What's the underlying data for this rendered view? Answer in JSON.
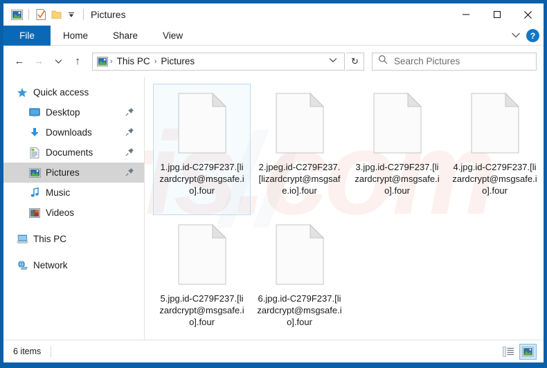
{
  "window": {
    "title": "Pictures",
    "quick_access_icons": [
      "pictures-folder-icon",
      "properties-checkmark-icon",
      "new-folder-icon",
      "customize-chevron-icon"
    ],
    "controls": {
      "minimize": "–",
      "maximize": "□",
      "close": "✕"
    }
  },
  "ribbon": {
    "tabs": [
      {
        "label": "File",
        "active": true
      },
      {
        "label": "Home",
        "active": false
      },
      {
        "label": "Share",
        "active": false
      },
      {
        "label": "View",
        "active": false
      }
    ],
    "expand_label": "˅",
    "help_label": "?"
  },
  "address": {
    "back": "←",
    "forward": "→",
    "recent": "˅",
    "up": "↑",
    "crumbs": [
      "This PC",
      "Pictures"
    ],
    "separator": "›",
    "dropdown": "˅",
    "refresh": "↻"
  },
  "search": {
    "placeholder": "Search Pictures",
    "icon": "search-icon"
  },
  "sidebar": {
    "items": [
      {
        "label": "Quick access",
        "icon": "star-icon",
        "level": 0,
        "pinned": false,
        "selected": false
      },
      {
        "label": "Desktop",
        "icon": "desktop-icon",
        "level": 1,
        "pinned": true,
        "selected": false
      },
      {
        "label": "Downloads",
        "icon": "downloads-icon",
        "level": 1,
        "pinned": true,
        "selected": false
      },
      {
        "label": "Documents",
        "icon": "documents-icon",
        "level": 1,
        "pinned": true,
        "selected": false
      },
      {
        "label": "Pictures",
        "icon": "pictures-icon",
        "level": 1,
        "pinned": true,
        "selected": true
      },
      {
        "label": "Music",
        "icon": "music-icon",
        "level": 1,
        "pinned": false,
        "selected": false
      },
      {
        "label": "Videos",
        "icon": "videos-icon",
        "level": 1,
        "pinned": false,
        "selected": false
      },
      {
        "label": "This PC",
        "icon": "this-pc-icon",
        "level": 0,
        "pinned": false,
        "selected": false
      },
      {
        "label": "Network",
        "icon": "network-icon",
        "level": 0,
        "pinned": false,
        "selected": false
      }
    ]
  },
  "files": [
    {
      "name": "1.jpg.id-C279F237.[lizardcrypt@msgsafe.io].four",
      "selected": true
    },
    {
      "name": "2.jpeg.id-C279F237.[lizardcrypt@msgsafe.io].four",
      "selected": false
    },
    {
      "name": "3.jpg.id-C279F237.[lizardcrypt@msgsafe.io].four",
      "selected": false
    },
    {
      "name": "4.jpg.id-C279F237.[lizardcrypt@msgsafe.io].four",
      "selected": false
    },
    {
      "name": "5.jpg.id-C279F237.[lizardcrypt@msgsafe.io].four",
      "selected": false
    },
    {
      "name": "6.jpg.id-C279F237.[lizardcrypt@msgsafe.io].four",
      "selected": false
    }
  ],
  "statusbar": {
    "item_count": "6 items",
    "views": [
      {
        "name": "details-view",
        "active": false
      },
      {
        "name": "large-icons-view",
        "active": true
      }
    ]
  },
  "watermark": {
    "text": "ris.com"
  },
  "colors": {
    "window_frame": "#0b5ea8",
    "file_tab": "#0a69b7",
    "selection": "#bcdcf4",
    "sidebar_selected": "#d4d4d4",
    "accent_blue": "#1577c4"
  }
}
